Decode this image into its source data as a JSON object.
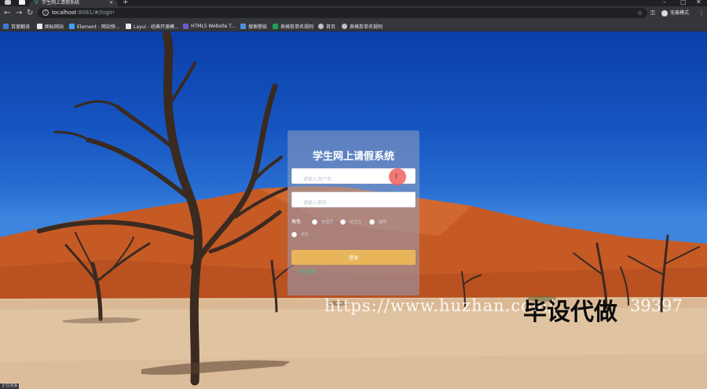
{
  "browser": {
    "tab_title": "学生网上请假系统",
    "tab_favicon": "vue-icon",
    "url_host": "localhost",
    "url_rest": ":8081/#/login",
    "profile_label": "无痕模式",
    "bookmarks": [
      {
        "label": "百度翻译",
        "icon": "baidu-translate-icon",
        "color": "#3a7bd5"
      },
      {
        "label": "图标网站",
        "icon": "bookmark-icon",
        "color": "#e8eaed"
      },
      {
        "label": "Element - 网站快...",
        "icon": "element-icon",
        "color": "#409eff"
      },
      {
        "label": "Layui - 经典开源模...",
        "icon": "layui-icon",
        "color": "#e8eaed"
      },
      {
        "label": "HTML5 Website T...",
        "icon": "html5-site-icon",
        "color": "#6b5bd6"
      },
      {
        "label": "搜索壁纸",
        "icon": "wallpaper-icon",
        "color": "#4a8fe0"
      },
      {
        "label": "表格剪单名规则",
        "icon": "sheet-icon",
        "color": "#1e9e55"
      },
      {
        "label": "首页",
        "icon": "globe-icon",
        "color": "#bdc1c6"
      },
      {
        "label": "表格剪单名规则",
        "icon": "globe-icon",
        "color": "#bdc1c6"
      }
    ]
  },
  "login": {
    "title": "学生网上请假系统",
    "username_placeholder": "请输入用户名",
    "password_placeholder": "请输入密码",
    "role_label": "角色",
    "roles": [
      "管理员",
      "班主任",
      "辅导",
      "学生"
    ],
    "submit_label": "登录",
    "register_link": "学生注册"
  },
  "watermark": {
    "url_text": "https://www.huzhan.com/",
    "cn_text": "毕设代做",
    "num_text": "39397"
  },
  "status": {
    "text": "正在连接..."
  },
  "colors": {
    "card_bg": "rgba(150,160,190,0.55)",
    "login_button": "#e9b55a",
    "register_link": "#3ec98f",
    "sky": "#1656c2",
    "dune": "#c65a25",
    "sand": "#e0c4a2"
  }
}
